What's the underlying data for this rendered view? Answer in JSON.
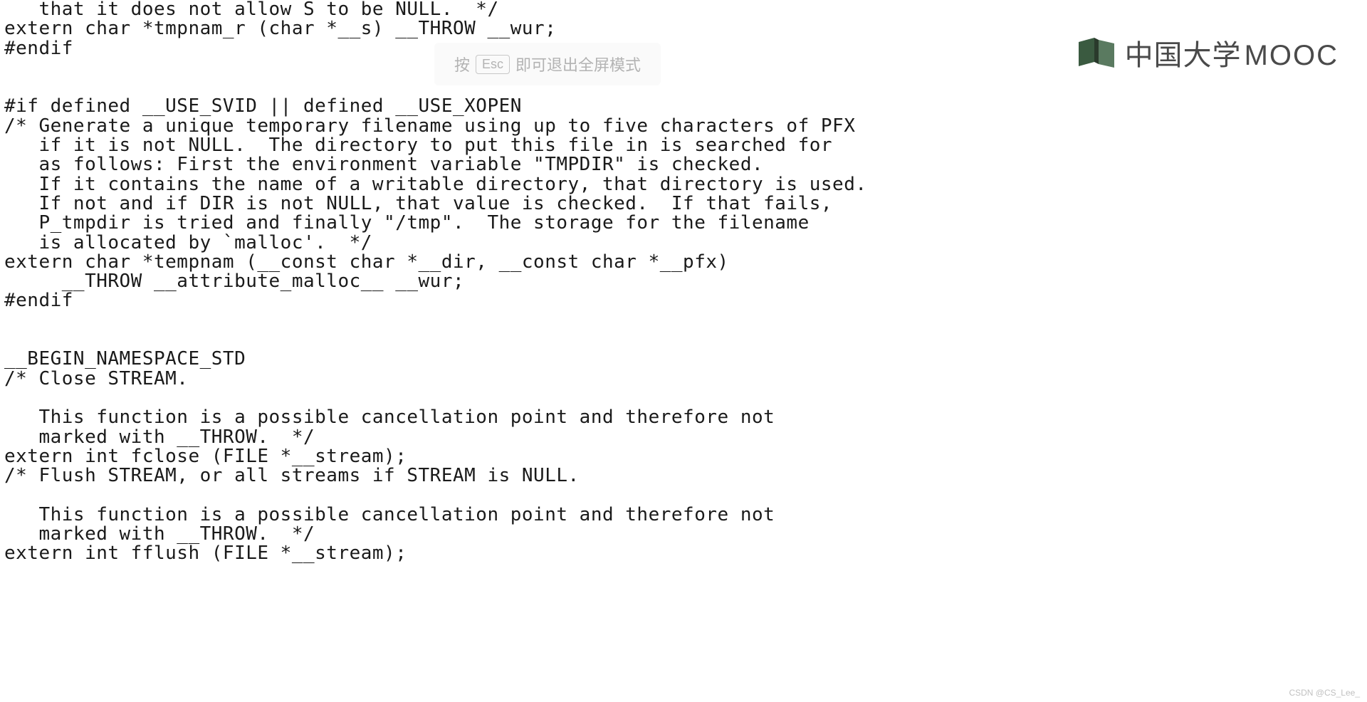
{
  "code": {
    "lines": [
      "   that it does not allow S to be NULL.  */",
      "extern char *tmpnam_r (char *__s) __THROW __wur;",
      "#endif",
      "",
      "",
      "#if defined __USE_SVID || defined __USE_XOPEN",
      "/* Generate a unique temporary filename using up to five characters of PFX",
      "   if it is not NULL.  The directory to put this file in is searched for",
      "   as follows: First the environment variable \"TMPDIR\" is checked.",
      "   If it contains the name of a writable directory, that directory is used.",
      "   If not and if DIR is not NULL, that value is checked.  If that fails,",
      "   P_tmpdir is tried and finally \"/tmp\".  The storage for the filename",
      "   is allocated by `malloc'.  */",
      "extern char *tempnam (__const char *__dir, __const char *__pfx)",
      "     __THROW __attribute_malloc__ __wur;",
      "#endif",
      "",
      "",
      "__BEGIN_NAMESPACE_STD",
      "/* Close STREAM.",
      "",
      "   This function is a possible cancellation point and therefore not",
      "   marked with __THROW.  */",
      "extern int fclose (FILE *__stream);",
      "/* Flush STREAM, or all streams if STREAM is NULL.",
      "",
      "   This function is a possible cancellation point and therefore not",
      "   marked with __THROW.  */",
      "extern int fflush (FILE *__stream);"
    ]
  },
  "overlay": {
    "prefix": "按",
    "key": "Esc",
    "suffix": "即可退出全屏模式"
  },
  "logo": {
    "text_cn": "中国大学",
    "text_en": "MOOC"
  },
  "watermark": "CSDN @CS_Lee_"
}
